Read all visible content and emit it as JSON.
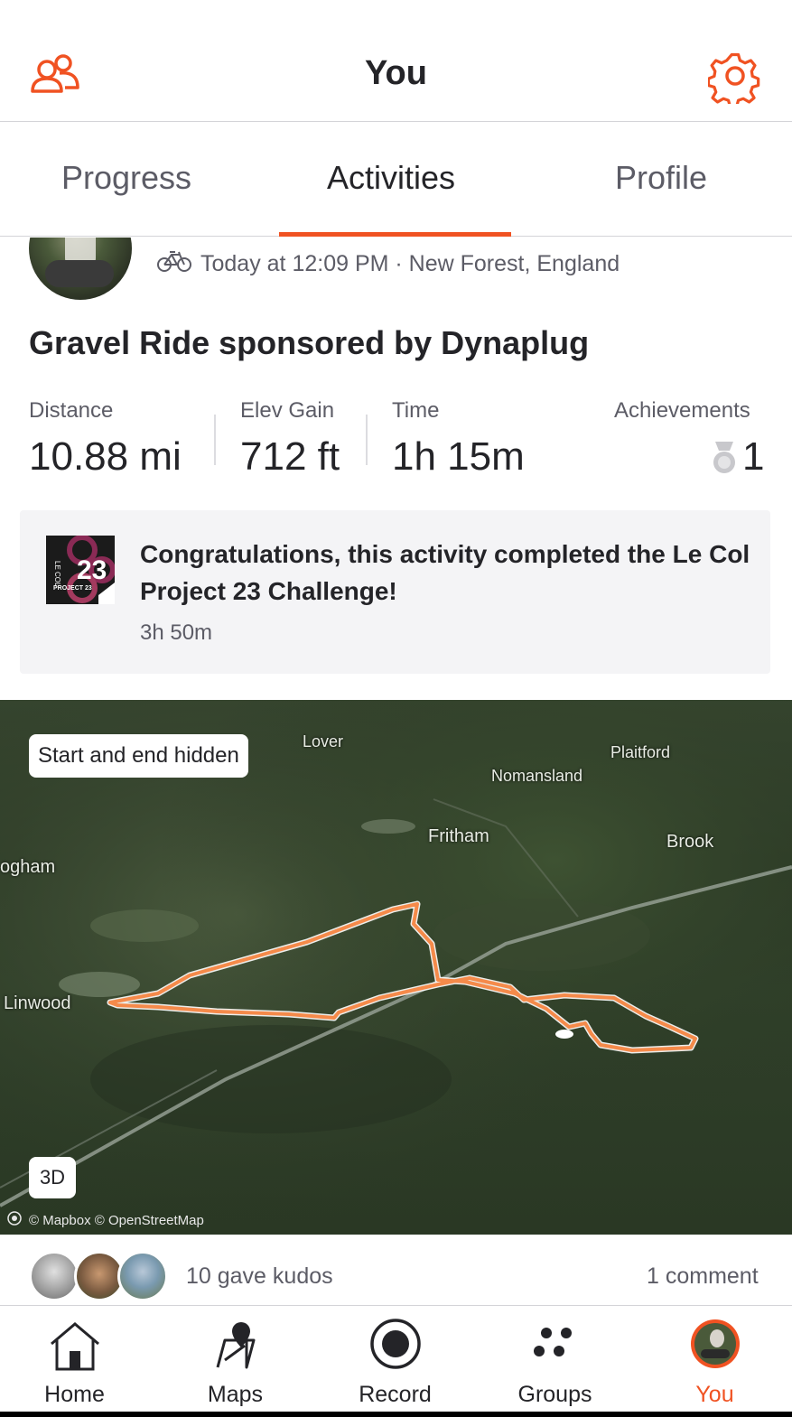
{
  "header": {
    "title": "You",
    "left_icon": "people-icon",
    "right_icon": "gear-icon"
  },
  "tabs": [
    {
      "label": "Progress",
      "active": false
    },
    {
      "label": "Activities",
      "active": true
    },
    {
      "label": "Profile",
      "active": false
    }
  ],
  "activity": {
    "sport_icon": "bike-icon",
    "meta": "Today at 12:09 PM · New Forest, England",
    "title": "Gravel Ride sponsored by Dynaplug",
    "stats": {
      "distance": {
        "label": "Distance",
        "value": "10.88 mi"
      },
      "elev_gain": {
        "label": "Elev Gain",
        "value": "712 ft"
      },
      "time": {
        "label": "Time",
        "value": "1h 15m"
      },
      "achievements": {
        "label": "Achievements",
        "value": "1"
      }
    },
    "challenge": {
      "badge_text_top": "LE COL",
      "badge_number": "23",
      "badge_text_bottom": "PROJECT 23",
      "text": "Congratulations, this activity completed the Le Col Project 23 Challenge!",
      "time": "3h 50m"
    },
    "map": {
      "hidden_label": "Start and end hidden",
      "three_d_label": "3D",
      "attribution": "© Mapbox © OpenStreetMap",
      "places": [
        "Lover",
        "Plaitford",
        "Nomansland",
        "Fritham",
        "Brook",
        "ogham",
        "Linwood"
      ],
      "route_color": "#f58a4a"
    },
    "kudos": "10 gave kudos",
    "comments": "1 comment"
  },
  "tabbar": [
    {
      "label": "Home",
      "icon": "home-icon",
      "active": false
    },
    {
      "label": "Maps",
      "icon": "map-icon",
      "active": false
    },
    {
      "label": "Record",
      "icon": "record-icon",
      "active": false
    },
    {
      "label": "Groups",
      "icon": "groups-icon",
      "active": false
    },
    {
      "label": "You",
      "icon": "avatar-icon",
      "active": true
    }
  ],
  "colors": {
    "accent": "#f05222",
    "text": "#242428",
    "muted": "#5c5c66"
  }
}
